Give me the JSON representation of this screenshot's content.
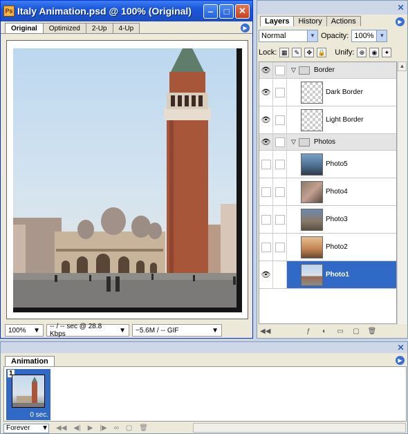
{
  "document": {
    "title": "Italy Animation.psd @ 100% (Original)",
    "tabs": [
      "Original",
      "Optimized",
      "2-Up",
      "4-Up"
    ],
    "status": {
      "zoom": "100%",
      "speed": "-- / -- sec @ 28.8 Kbps",
      "size": "~5.6M / -- GIF"
    }
  },
  "layers_panel": {
    "tabs": [
      "Layers",
      "History",
      "Actions"
    ],
    "blend_mode": "Normal",
    "opacity_label": "Opacity:",
    "opacity_value": "100%",
    "lock_label": "Lock:",
    "unify_label": "Unify:",
    "groups": [
      {
        "name": "Border",
        "visible": true,
        "layers": [
          {
            "name": "Dark Border",
            "visible": true
          },
          {
            "name": "Light Border",
            "visible": true
          }
        ]
      },
      {
        "name": "Photos",
        "visible": true,
        "layers": [
          {
            "name": "Photo5",
            "visible": false
          },
          {
            "name": "Photo4",
            "visible": false
          },
          {
            "name": "Photo3",
            "visible": false
          },
          {
            "name": "Photo2",
            "visible": false
          },
          {
            "name": "Photo1",
            "visible": true,
            "selected": true
          }
        ]
      }
    ]
  },
  "animation_panel": {
    "tab": "Animation",
    "frame_number": "1",
    "frame_delay": "0 sec.",
    "loop": "Forever"
  },
  "colors": {
    "selection": "#3169c6",
    "titlebar": "#1a56d9"
  }
}
